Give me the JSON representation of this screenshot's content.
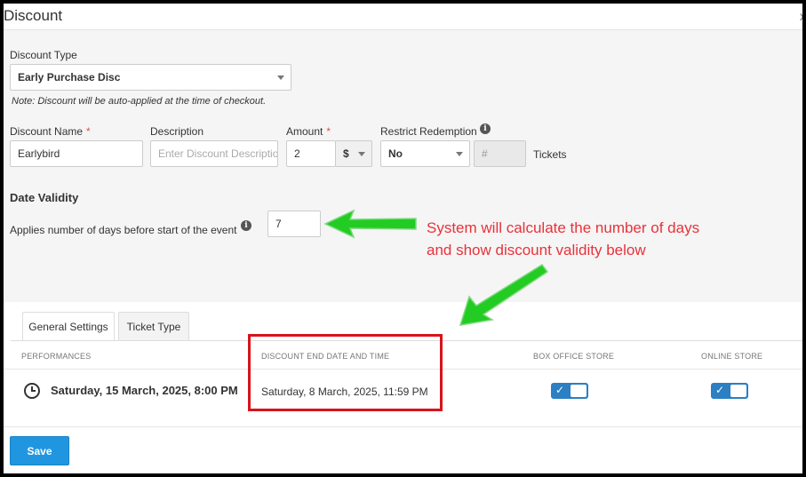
{
  "dialog": {
    "title": "Discount",
    "close": "x"
  },
  "discount_type": {
    "label": "Discount Type",
    "value": "Early Purchase Disc",
    "note": "Note: Discount will be auto-applied at the time of checkout."
  },
  "discount_name": {
    "label": "Discount Name",
    "required": "*",
    "value": "Earlybird"
  },
  "description": {
    "label": "Description",
    "placeholder": "Enter Discount Descriptio"
  },
  "amount": {
    "label": "Amount",
    "required": "*",
    "value": "2",
    "unit": "$"
  },
  "restrict": {
    "label": "Restrict Redemption",
    "value": "No",
    "count_placeholder": "#",
    "suffix": "Tickets"
  },
  "date_validity": {
    "title": "Date Validity",
    "days_label": "Applies number of days before start of the event",
    "days_value": "7"
  },
  "annotation": {
    "line1": "System will calculate the number of days",
    "line2": "and show discount validity below"
  },
  "tabs": [
    {
      "label": "General Settings",
      "active": true
    },
    {
      "label": "Ticket Type",
      "active": false
    }
  ],
  "table": {
    "headers": [
      "PERFORMANCES",
      "DISCOUNT END DATE AND TIME",
      "BOX OFFICE STORE",
      "ONLINE STORE"
    ],
    "rows": [
      {
        "performance": "Saturday, 15 March, 2025, 8:00 PM",
        "end_date": "Saturday, 8 March, 2025, 11:59 PM",
        "box_office": true,
        "online": true
      }
    ]
  },
  "save_label": "Save",
  "colors": {
    "accent": "#2196e0",
    "toggle": "#2b7fc2",
    "annotation": "#e8323a",
    "arrow": "#22cc22",
    "highlight_box": "#d7141a"
  }
}
